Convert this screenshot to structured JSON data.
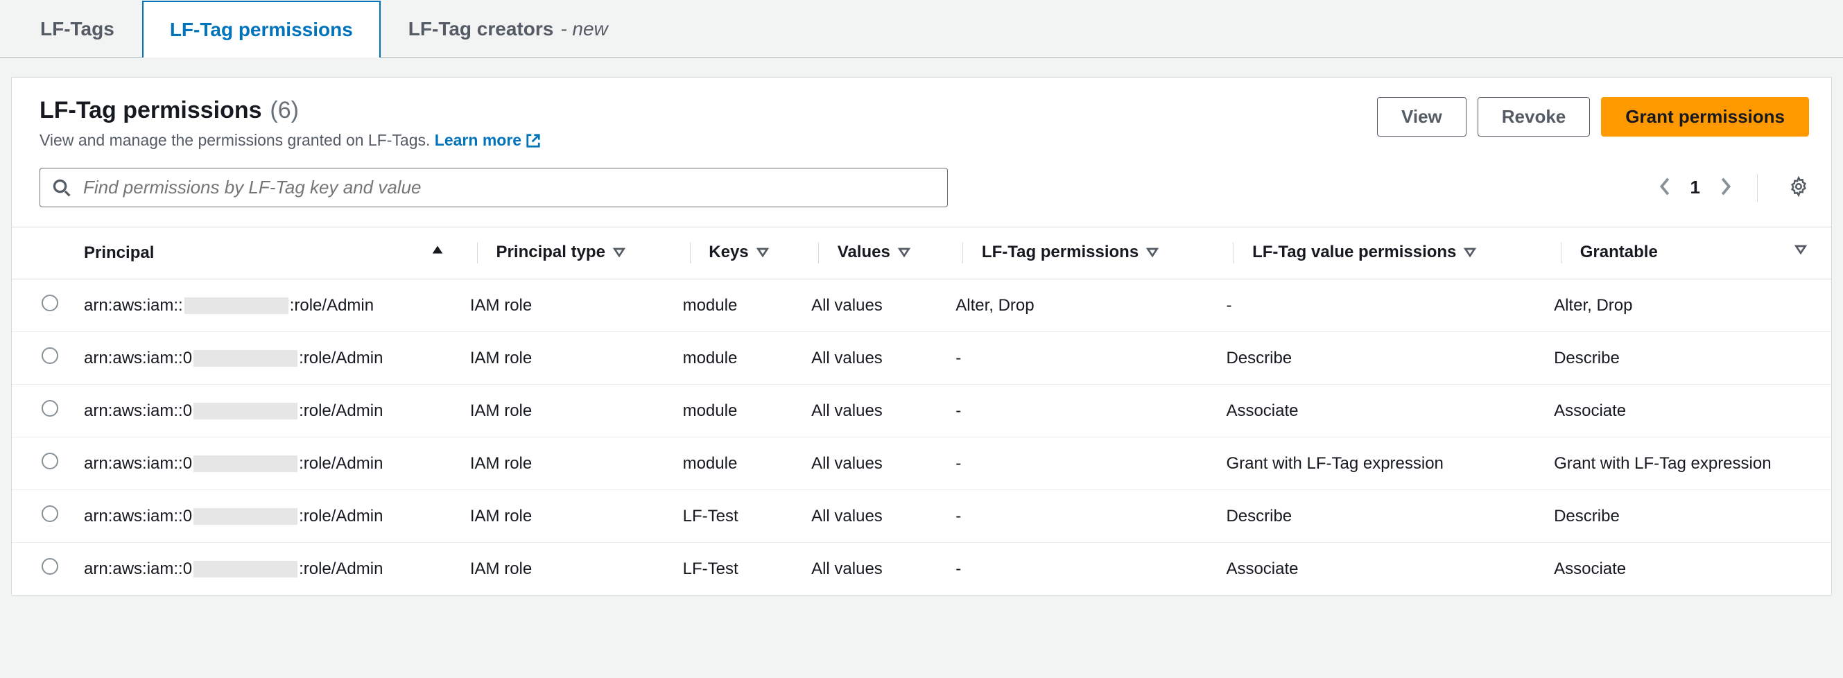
{
  "tabs": [
    {
      "label": "LF-Tags",
      "active": false,
      "is_new": false
    },
    {
      "label": "LF-Tag permissions",
      "active": true,
      "is_new": false
    },
    {
      "label": "LF-Tag creators",
      "active": false,
      "is_new": true,
      "new_label": "- new"
    }
  ],
  "panel": {
    "title": "LF-Tag permissions",
    "count_display": "(6)",
    "description": "View and manage the permissions granted on LF-Tags.",
    "learn_more_label": "Learn more"
  },
  "actions": {
    "view": "View",
    "revoke": "Revoke",
    "grant": "Grant permissions"
  },
  "search": {
    "placeholder": "Find permissions by LF-Tag key and value"
  },
  "pagination": {
    "current": "1"
  },
  "table": {
    "columns": {
      "principal": "Principal",
      "principal_type": "Principal type",
      "keys": "Keys",
      "values": "Values",
      "lftag_perms": "LF-Tag permissions",
      "lftag_value_perms": "LF-Tag value permissions",
      "grantable": "Grantable"
    },
    "rows": [
      {
        "principal_pre": "arn:aws:iam::",
        "principal_post": ":role/Admin",
        "principal_type": "IAM role",
        "keys": "module",
        "values": "All values",
        "lftag_perms": "Alter, Drop",
        "lftag_value_perms": "-",
        "grantable": "Alter, Drop"
      },
      {
        "principal_pre": "arn:aws:iam::0",
        "principal_post": ":role/Admin",
        "principal_type": "IAM role",
        "keys": "module",
        "values": "All values",
        "lftag_perms": "-",
        "lftag_value_perms": "Describe",
        "grantable": "Describe"
      },
      {
        "principal_pre": "arn:aws:iam::0",
        "principal_post": ":role/Admin",
        "principal_type": "IAM role",
        "keys": "module",
        "values": "All values",
        "lftag_perms": "-",
        "lftag_value_perms": "Associate",
        "grantable": "Associate"
      },
      {
        "principal_pre": "arn:aws:iam::0",
        "principal_post": ":role/Admin",
        "principal_type": "IAM role",
        "keys": "module",
        "values": "All values",
        "lftag_perms": "-",
        "lftag_value_perms": "Grant with LF-Tag expression",
        "grantable": "Grant with LF-Tag expression"
      },
      {
        "principal_pre": "arn:aws:iam::0",
        "principal_post": ":role/Admin",
        "principal_type": "IAM role",
        "keys": "LF-Test",
        "values": "All values",
        "lftag_perms": "-",
        "lftag_value_perms": "Describe",
        "grantable": "Describe"
      },
      {
        "principal_pre": "arn:aws:iam::0",
        "principal_post": ":role/Admin",
        "principal_type": "IAM role",
        "keys": "LF-Test",
        "values": "All values",
        "lftag_perms": "-",
        "lftag_value_perms": "Associate",
        "grantable": "Associate"
      }
    ]
  }
}
